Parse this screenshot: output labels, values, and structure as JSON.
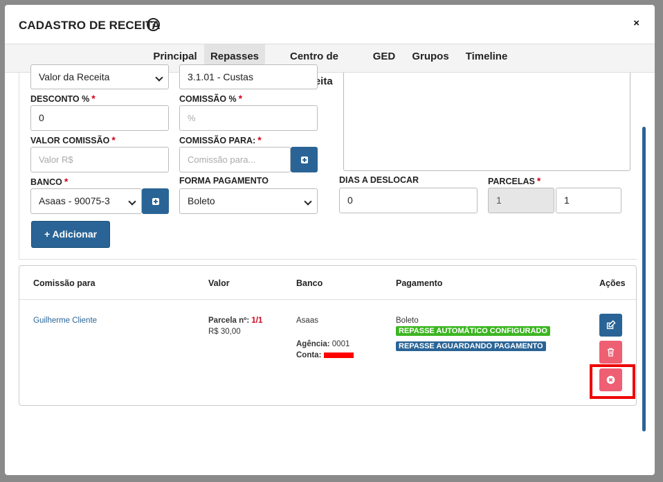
{
  "header": {
    "title": "CADASTRO DE RECEITA",
    "help_icon": "?",
    "close_icon": "×"
  },
  "tabs": [
    {
      "label": "Principal"
    },
    {
      "label": "Repasses"
    },
    {
      "label": "Centro de Receita"
    },
    {
      "label": "GED"
    },
    {
      "label": "Grupos"
    },
    {
      "label": "Timeline"
    }
  ],
  "active_tab": "Repasses",
  "form": {
    "base_select": "Valor da Receita",
    "centro_value": "3.1.01 - Custas",
    "desconto_label": "DESCONTO %",
    "desconto_value": "0",
    "comissao_pct_label": "COMISSÃO %",
    "comissao_pct_placeholder": "%",
    "valor_comissao_label": "VALOR COMISSÃO",
    "valor_comissao_placeholder": "Valor R$",
    "comissao_para_label": "COMISSÃO PARA:",
    "comissao_para_placeholder": "Comissão para...",
    "banco_label": "BANCO",
    "banco_value": "Asaas - 90075-3",
    "forma_pagamento_label": "FORMA PAGAMENTO",
    "forma_pagamento_value": "Boleto",
    "dias_label": "DIAS A DESLOCAR",
    "dias_value": "0",
    "parcelas_label": "PARCELAS",
    "parcelas_disabled_value": "1",
    "parcelas_value": "1",
    "required_mark": "*",
    "add_button": "+ Adicionar"
  },
  "table": {
    "columns": [
      "Comissão para",
      "Valor",
      "Banco",
      "Pagamento",
      "Ações"
    ],
    "rows": [
      {
        "comissao_para": "Guilherme Cliente",
        "parcela_label": "Parcela nº:",
        "parcela_value": "1/1",
        "valor": "R$ 30,00",
        "banco": "Asaas",
        "agencia_label": "Agência:",
        "agencia_value": "0001",
        "conta_label": "Conta:",
        "pagamento": "Boleto",
        "badges": [
          "REPASSE AUTOMÁTICO CONFIGURADO",
          "REPASSE AGUARDANDO PAGAMENTO"
        ]
      }
    ]
  },
  "colors": {
    "primary": "#2a6496",
    "danger": "#ee5f73",
    "success": "#3cb521",
    "required": "#d0021b",
    "highlight": "#ee0000"
  }
}
